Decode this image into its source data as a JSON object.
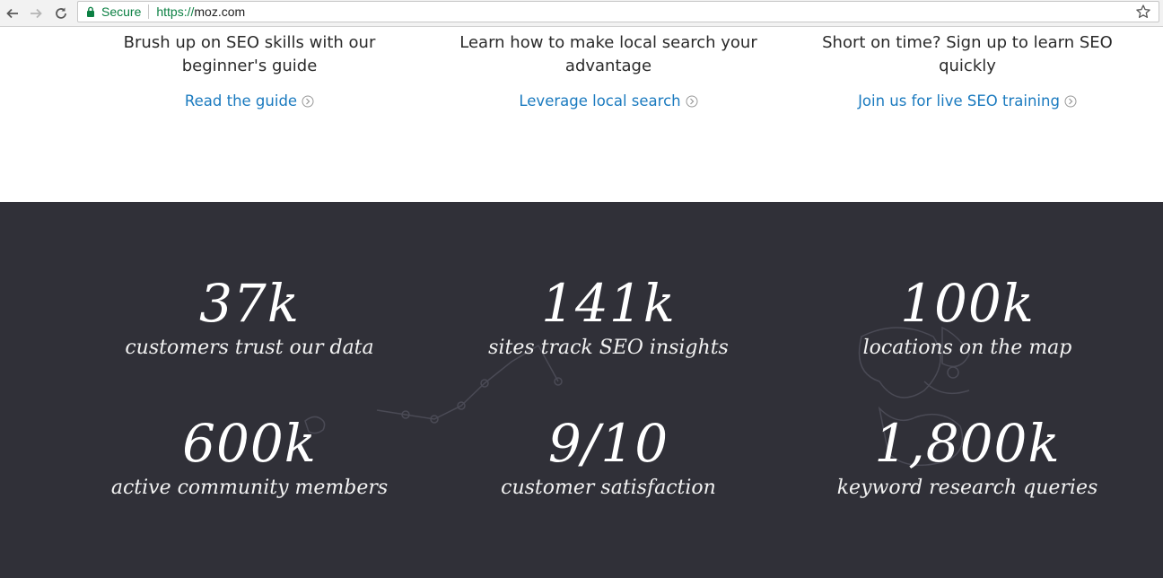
{
  "browser": {
    "secure_label": "Secure",
    "url_scheme": "https://",
    "url_host": "moz.com"
  },
  "features": [
    {
      "heading": "Brush up on SEO skills with our beginner's guide",
      "link": "Read the guide"
    },
    {
      "heading": "Learn how to make local search your advantage",
      "link": "Leverage local search"
    },
    {
      "heading": "Short on time? Sign up to learn SEO quickly",
      "link": "Join us for live SEO training"
    }
  ],
  "stats": [
    {
      "value": "37k",
      "label": "customers trust our data"
    },
    {
      "value": "141k",
      "label": "sites track SEO insights"
    },
    {
      "value": "100k",
      "label": "locations on the map"
    },
    {
      "value": "600k",
      "label": "active community members"
    },
    {
      "value": "9/10",
      "label": "customer satisfaction"
    },
    {
      "value": "1,800k",
      "label": "keyword research queries"
    }
  ],
  "colors": {
    "link": "#1a7abf",
    "secure": "#0b8043",
    "chalkboard": "#303038"
  }
}
